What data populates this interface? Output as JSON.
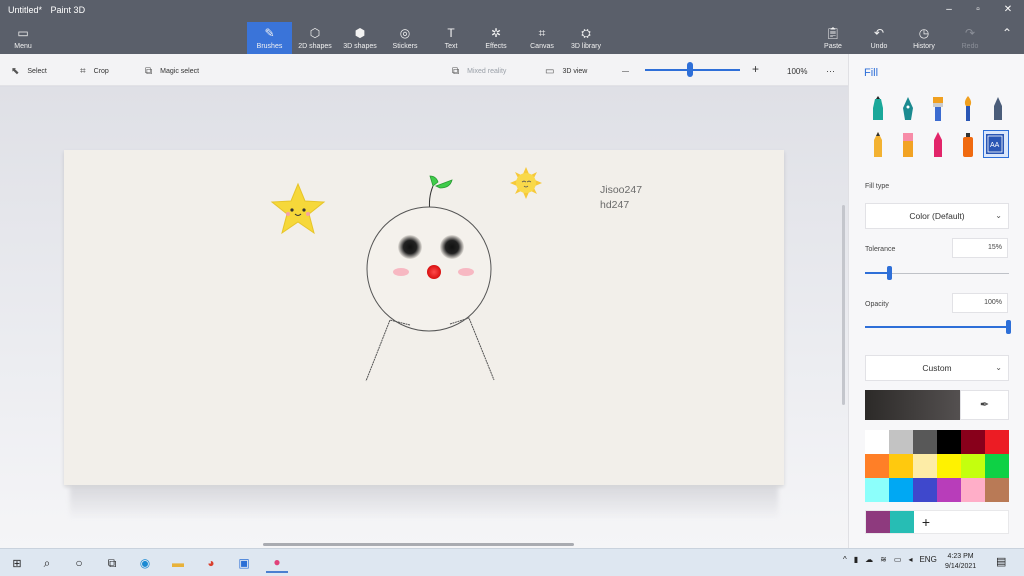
{
  "window": {
    "doc_title": "Untitled*",
    "app_title": "Paint 3D",
    "minimize": "–",
    "maximize": "▫",
    "close": "✕"
  },
  "toolbar": {
    "menu": "Menu",
    "tools": [
      {
        "label": "Brushes",
        "icon": "✎"
      },
      {
        "label": "2D shapes",
        "icon": "⬡"
      },
      {
        "label": "3D shapes",
        "icon": "⬢"
      },
      {
        "label": "Stickers",
        "icon": "◎"
      },
      {
        "label": "Text",
        "icon": "T"
      },
      {
        "label": "Effects",
        "icon": "✲"
      },
      {
        "label": "Canvas",
        "icon": "⌗"
      },
      {
        "label": "3D library",
        "icon": "⛭"
      }
    ],
    "paste": "Paste",
    "undo": "Undo",
    "history": "History",
    "redo": "Redo",
    "collapse": "⌃"
  },
  "subbar": {
    "select": "Select",
    "crop": "Crop",
    "magic_select": "Magic select",
    "mixed_reality": "Mixed reality",
    "view_3d": "3D view",
    "zoom_minus": "—",
    "zoom_plus": "+",
    "zoom_percent": "100%",
    "zoom_fraction": 0.47,
    "more": "···"
  },
  "canvas": {
    "text_line1": "Jisoo247",
    "text_line2": "hd247"
  },
  "panel": {
    "title": "Fill",
    "fill_type_label": "Fill type",
    "fill_type_value": "Color (Default)",
    "tolerance_label": "Tolerance",
    "tolerance_value": "15%",
    "tolerance_fraction": 0.15,
    "opacity_label": "Opacity",
    "opacity_value": "100%",
    "opacity_fraction": 1.0,
    "color_mode": "Custom",
    "current_color": "#2c2a28",
    "palette": [
      "#ffffff",
      "#c3c3c3",
      "#585858",
      "#000000",
      "#88001b",
      "#ec1c24",
      "#ff7f27",
      "#ffc90e",
      "#fdeca6",
      "#fff200",
      "#c4ff0e",
      "#0ed145",
      "#8cfffb",
      "#00a8f3",
      "#3f48cc",
      "#b83dba",
      "#ffaec8",
      "#b97a56"
    ],
    "custom_colors": [
      "#8e3a7e",
      "#27bdb4"
    ],
    "add_color": "+"
  },
  "taskbar": {
    "time": "4:23 PM",
    "date": "9/14/2021",
    "lang": "ENG"
  }
}
